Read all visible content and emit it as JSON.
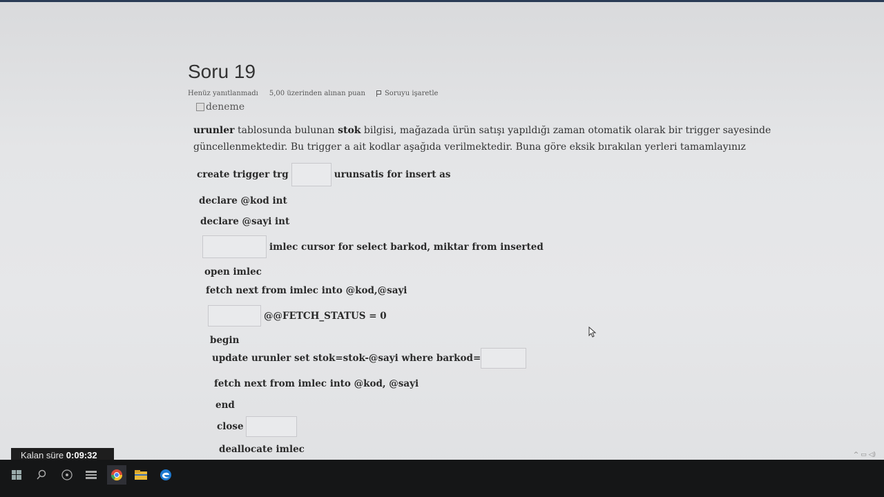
{
  "question": {
    "title": "Soru 19",
    "status": "Henüz yanıtlanmadı",
    "points": "5,00 üzerinden alınan puan",
    "flag_label": "Soruyu işaretle",
    "image_alt": "deneme"
  },
  "description": {
    "w1": "urunler",
    "t1": " tablosunda bulunan ",
    "w2": "stok",
    "t2": " bilgisi, mağazada ürün satışı yapıldığı zaman otomatik olarak bir trigger sayesinde güncellenmektedir. Bu trigger a ait kodlar aşağıda verilmektedir. Buna göre eksik bırakılan yerleri tamamlayınız"
  },
  "code": {
    "l1_before": "create trigger trg",
    "l1_after": "urunsatis for insert as",
    "l2": "declare @kod int",
    "l3": "declare @sayi int",
    "l4_after": "imlec cursor for select barkod, miktar from inserted",
    "l5": "open imlec",
    "l6": "fetch next from imlec into @kod,@sayi",
    "l7_after": "@@FETCH_STATUS = 0",
    "l8": "begin",
    "l9_before": "update urunler set stok=stok-@sayi where barkod=",
    "l10": "fetch next from imlec into @kod, @sayi",
    "l11": "end",
    "l12_before": "close",
    "l13": "deallocate imlec"
  },
  "blanks": [
    "",
    "",
    "",
    "",
    ""
  ],
  "timer": {
    "label": "Kalan süre",
    "value": "0:09:32"
  },
  "taskbar": {
    "icons": [
      "windows-icon",
      "search-icon",
      "task-view-icon",
      "multitask-icon",
      "chrome-icon",
      "file-explorer-icon",
      "edge-icon"
    ]
  }
}
